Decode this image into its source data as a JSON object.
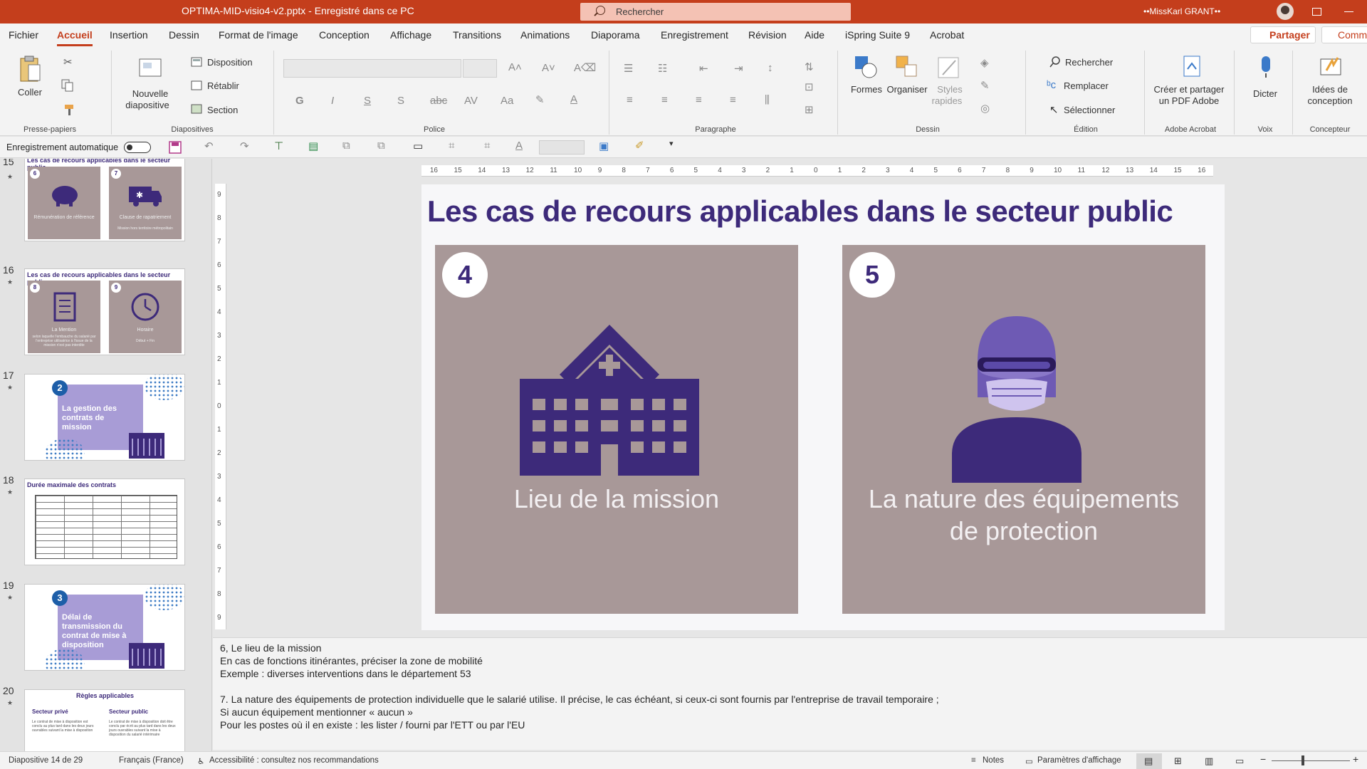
{
  "titlebar": {
    "document": "OPTIMA-MID-visio4-v2.pptx  -  Enregistré dans ce PC",
    "search_placeholder": "Rechercher",
    "user": "••MissKarl GRANT••"
  },
  "menu": {
    "tabs": [
      "Fichier",
      "Accueil",
      "Insertion",
      "Dessin",
      "Format de l'image",
      "Conception",
      "Affichage",
      "Transitions",
      "Animations",
      "Diaporama",
      "Enregistrement",
      "Révision",
      "Aide",
      "iSpring Suite 9",
      "Acrobat"
    ],
    "active_tab": "Accueil",
    "share": "Partager",
    "comments": "Comm"
  },
  "ribbon": {
    "clipboard": {
      "paste": "Coller",
      "group": "Presse-papiers"
    },
    "slides": {
      "new_slide_1": "Nouvelle",
      "new_slide_2": "diapositive",
      "layout": "Disposition",
      "reset": "Rétablir",
      "section": "Section",
      "group": "Diapositives"
    },
    "font": {
      "group": "Police"
    },
    "paragraph": {
      "group": "Paragraphe"
    },
    "drawing": {
      "shapes": "Formes",
      "arrange": "Organiser",
      "styles_1": "Styles",
      "styles_2": "rapides",
      "group": "Dessin"
    },
    "editing": {
      "find": "Rechercher",
      "replace": "Remplacer",
      "select": "Sélectionner",
      "group": "Édition"
    },
    "acrobat": {
      "create_1": "Créer et partager",
      "create_2": "un PDF Adobe",
      "group": "Adobe Acrobat"
    },
    "voice": {
      "dictate": "Dicter",
      "group": "Voix"
    },
    "designer": {
      "ideas_1": "Idées de",
      "ideas_2": "conception",
      "group": "Concepteur"
    }
  },
  "qat": {
    "autosave": "Enregistrement automatique"
  },
  "thumbnails": [
    {
      "number": "15",
      "title": "Les cas de recours applicables dans le secteur public",
      "panels": [
        {
          "n": "6",
          "label": "Rémunération de référence",
          "sub": ""
        },
        {
          "n": "7",
          "label": "Clause de rapatriement",
          "sub": "Mission hors territoire métropolitain"
        }
      ]
    },
    {
      "number": "16",
      "title": "Les cas de recours applicables dans le secteur public",
      "panels": [
        {
          "n": "8",
          "label": "La Mention",
          "sub": "selon laquelle l'embauche du salarié par l'entreprise utilisatrice à l'issue de la mission n'est pas interdite"
        },
        {
          "n": "9",
          "label": "Horaire",
          "sub": "Début + Fin"
        }
      ]
    },
    {
      "number": "17",
      "badge": "2",
      "text": "La gestion des contrats de mission"
    },
    {
      "number": "18",
      "title": "Durée maximale des contrats"
    },
    {
      "number": "19",
      "badge": "3",
      "text": "Délai de transmission du contrat de mise à disposition"
    },
    {
      "number": "20",
      "title": "Règles applicables",
      "col1": "Secteur privé",
      "col2": "Secteur public",
      "body1": "Le contrat de mise à disposition est conclu au plus tard dans les deux jours ouvrables suivant la mise à disposition",
      "body2": "Le contrat de mise à disposition doit être conclu par écrit au plus tard dans les deux jours ouvrables suivant la mise à disposition du salarié intérimaire"
    }
  ],
  "ruler": {
    "h_ticks": [
      "16",
      "15",
      "14",
      "13",
      "12",
      "11",
      "10",
      "9",
      "8",
      "7",
      "6",
      "5",
      "4",
      "3",
      "2",
      "1",
      "0",
      "1",
      "2",
      "3",
      "4",
      "5",
      "6",
      "7",
      "8",
      "9",
      "10",
      "11",
      "12",
      "13",
      "14",
      "15",
      "16"
    ],
    "v_ticks": [
      "9",
      "8",
      "7",
      "6",
      "5",
      "4",
      "3",
      "2",
      "1",
      "0",
      "1",
      "2",
      "3",
      "4",
      "5",
      "6",
      "7",
      "8",
      "9"
    ]
  },
  "slide": {
    "title": "Les cas de recours applicables dans le secteur public",
    "cards": [
      {
        "number": "4",
        "caption_1": "Lieu de la mission",
        "caption_2": "",
        "icon": "hospital-icon"
      },
      {
        "number": "5",
        "caption_1": "La nature des équipements",
        "caption_2": "de protection",
        "icon": "protective-equipment-icon"
      }
    ],
    "colors": {
      "title": "#3d2a7a",
      "card": "#a89898",
      "icon": "#3d2a7a"
    }
  },
  "notes": [
    "6,  Le lieu de la mission",
    "En cas de fonctions itinérantes, préciser la zone de mobilité",
    "Exemple : diverses interventions dans le département 53",
    "",
    "7.  La nature des équipements de protection individuelle que le salarié utilise. Il précise, le cas échéant, si ceux-ci sont fournis par l'entreprise de travail temporaire ;",
    " Si aucun équipement mentionner « aucun »",
    " Pour les postes où il en existe : les lister / fourni par l'ETT ou par l'EU"
  ],
  "status": {
    "slide_count": "Diapositive 14 de 29",
    "language": "Français (France)",
    "accessibility": "Accessibilité : consultez nos recommandations",
    "notes": "Notes",
    "display": "Paramètres d'affichage"
  }
}
